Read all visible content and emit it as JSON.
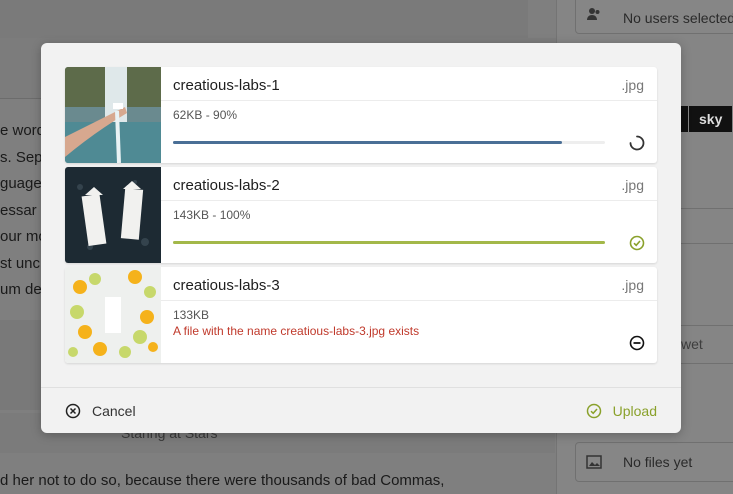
{
  "background": {
    "paragraph_fragments": [
      "e word",
      "s. Sep",
      "guage",
      "essar",
      "our mo",
      "st unc",
      "um de"
    ],
    "staring_text": "Staring at Stars",
    "bottom_text": "d her not to do so, because there were thousands of bad Commas,"
  },
  "sidebar": {
    "users_label": "No users selected",
    "tags": [
      "sky"
    ],
    "wet_label": "wet",
    "files_label": "No files yet"
  },
  "modal": {
    "files": [
      {
        "name": "creatious-labs-1",
        "ext": ".jpg",
        "info": "62KB - 90%",
        "progress": 0.9,
        "status": "uploading",
        "status_icon": "spinner-icon",
        "bar_color": "#4a6f96",
        "error": ""
      },
      {
        "name": "creatious-labs-2",
        "ext": ".jpg",
        "info": "143KB - 100%",
        "progress": 1.0,
        "status": "complete",
        "status_icon": "check-circle-icon",
        "bar_color": "#a3b849",
        "error": ""
      },
      {
        "name": "creatious-labs-3",
        "ext": ".jpg",
        "info": "133KB",
        "progress": null,
        "status": "error",
        "status_icon": "minus-circle-icon",
        "bar_color": "",
        "error": "A file with the name creatious-labs-3.jpg exists"
      }
    ],
    "cancel_label": "Cancel",
    "upload_label": "Upload",
    "colors": {
      "accent": "#8aa12b",
      "error": "#c0392b",
      "progress_blue": "#4a6f96"
    }
  }
}
